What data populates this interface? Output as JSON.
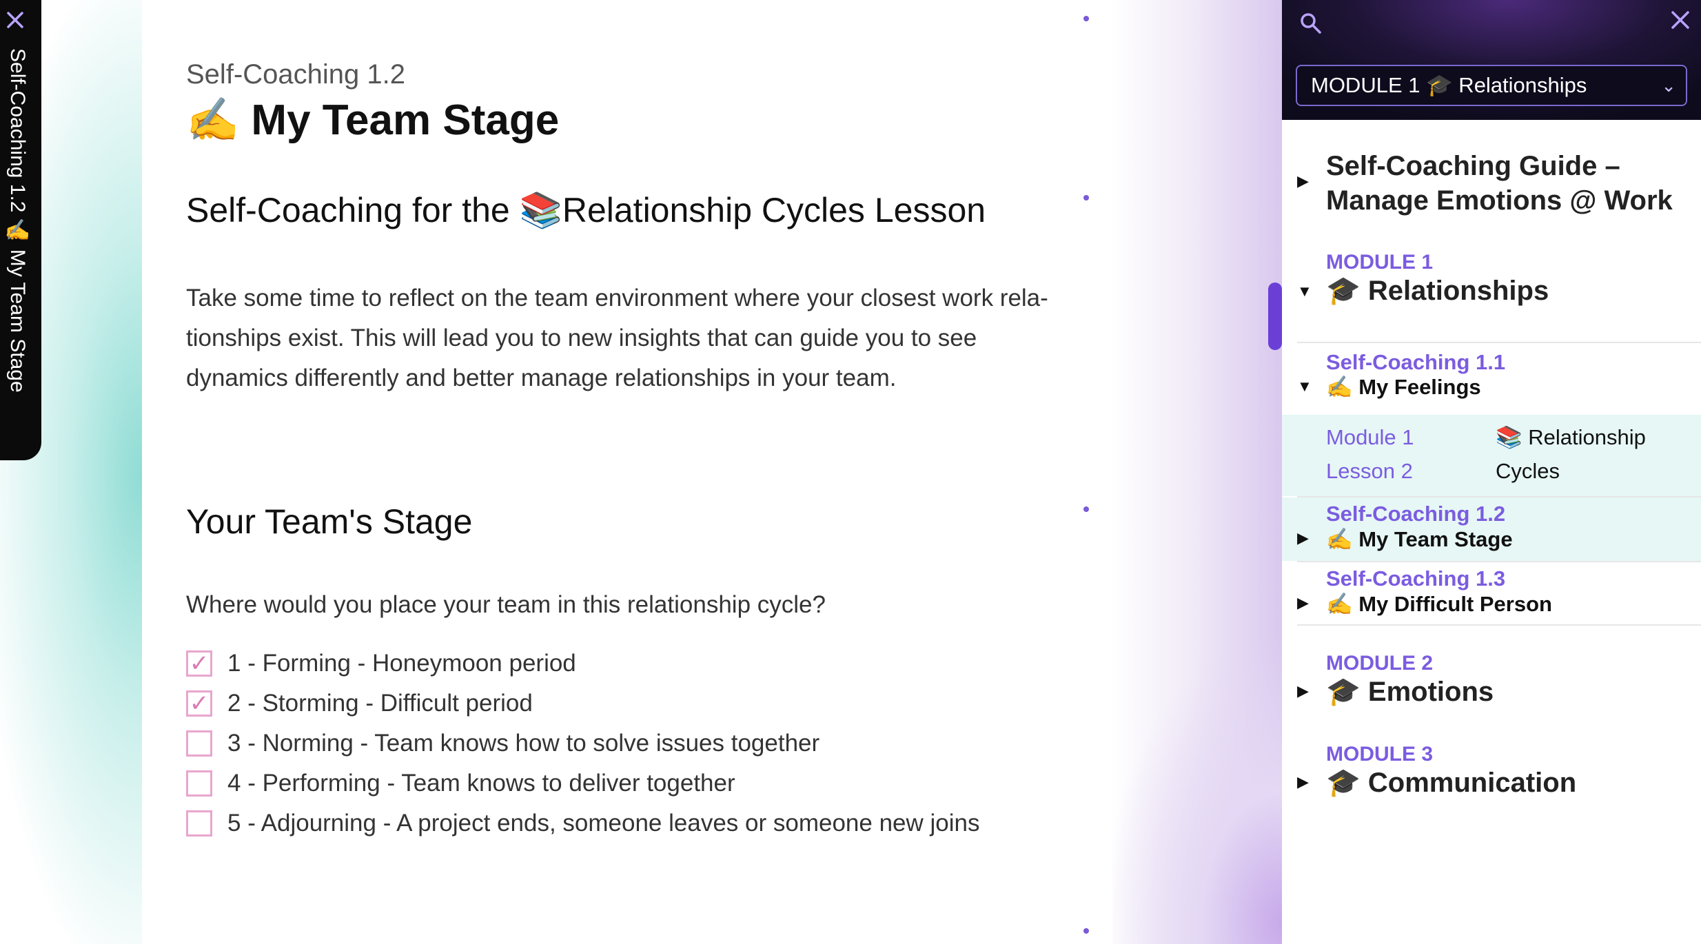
{
  "vertical_tab": {
    "close_icon": "close-icon",
    "label": "Self-Coaching 1.2 ✍️ My Team Stage"
  },
  "main": {
    "kicker": "Self-Coaching 1.2",
    "title": "✍️ My Team Stage",
    "lesson_heading": "Self-Coaching for the 📚Relationship Cycles Lesson",
    "intro": "Take some time to reflect on the team environment where your closest work rela-tionships exist. This will lead you to new insights that can guide you to see dynamics differently and better manage relationships in your team.",
    "stage_heading": "Your Team's Stage",
    "question": "Where would you place your team in this relationship cycle?",
    "options": [
      {
        "label": "1 - Forming - Honeymoon period",
        "checked": true
      },
      {
        "label": "2 - Storming - Difficult period",
        "checked": true
      },
      {
        "label": "3 - Norming - Team knows how to solve issues together",
        "checked": false
      },
      {
        "label": "4 - Performing - Team knows to deliver together",
        "checked": false
      },
      {
        "label": "5 - Adjourning - A project ends, someone leaves or someone new joins",
        "checked": false
      }
    ],
    "check_mark": "✓"
  },
  "sidebar": {
    "select_value": "MODULE 1 🎓 Relationships",
    "select_chevron": "⌄",
    "close_glyph": "✕",
    "guide_title": "Self-Coaching Guide – Manage Emotions @ Work",
    "modules": [
      {
        "label": "MODULE 1",
        "title": "🎓 Relationships",
        "expanded": true
      },
      {
        "label": "MODULE 2",
        "title": "🎓 Emotions",
        "expanded": false
      },
      {
        "label": "MODULE 3",
        "title": "🎓 Communication",
        "expanded": false
      }
    ],
    "self_coaching": [
      {
        "label": "Self-Coaching 1.1",
        "title": "✍️ My Feelings",
        "expanded": true
      },
      {
        "label": "Self-Coaching 1.2",
        "title": "✍️ My Team Stage",
        "expanded": false,
        "active": true
      },
      {
        "label": "Self-Coaching 1.3",
        "title": "✍️ My Difficult Person",
        "expanded": false
      }
    ],
    "lesson": {
      "left_line1": "Module 1",
      "left_line2": "Lesson 2",
      "right_line1": "📚 Relationship",
      "right_line2": "Cycles"
    },
    "arrows": {
      "expanded": "▼",
      "collapsed": "▶"
    }
  },
  "colors": {
    "accent": "#7b5ce0",
    "checkbox": "#e8a6cf",
    "highlight": "#e6f7f5",
    "header_dark": "#0e0b1c"
  }
}
